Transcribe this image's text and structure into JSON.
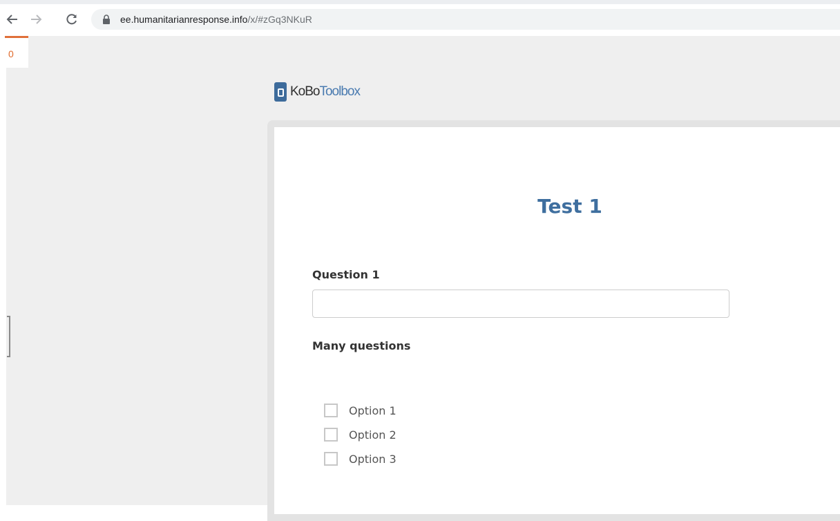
{
  "browser": {
    "url_host": "ee.humanitarianresponse.info",
    "url_path": "/x/#zGq3NKuR",
    "icons": [
      "back-arrow-icon",
      "forward-arrow-icon",
      "reload-icon",
      "lock-icon"
    ]
  },
  "sidebar": {
    "counter": "0",
    "accent_color": "#e06a2c"
  },
  "logo": {
    "kobo": "KoBo",
    "toolbox": "Toolbox",
    "brand_color": "#3d6b9b"
  },
  "form": {
    "title": "Test 1",
    "title_color": "#3f6f9f",
    "question1": {
      "label": "Question 1",
      "value": "",
      "placeholder": ""
    },
    "question2": {
      "label": "Many questions",
      "options": [
        {
          "label": "Option 1",
          "checked": false
        },
        {
          "label": "Option 2",
          "checked": false
        },
        {
          "label": "Option 3",
          "checked": false
        }
      ]
    }
  }
}
